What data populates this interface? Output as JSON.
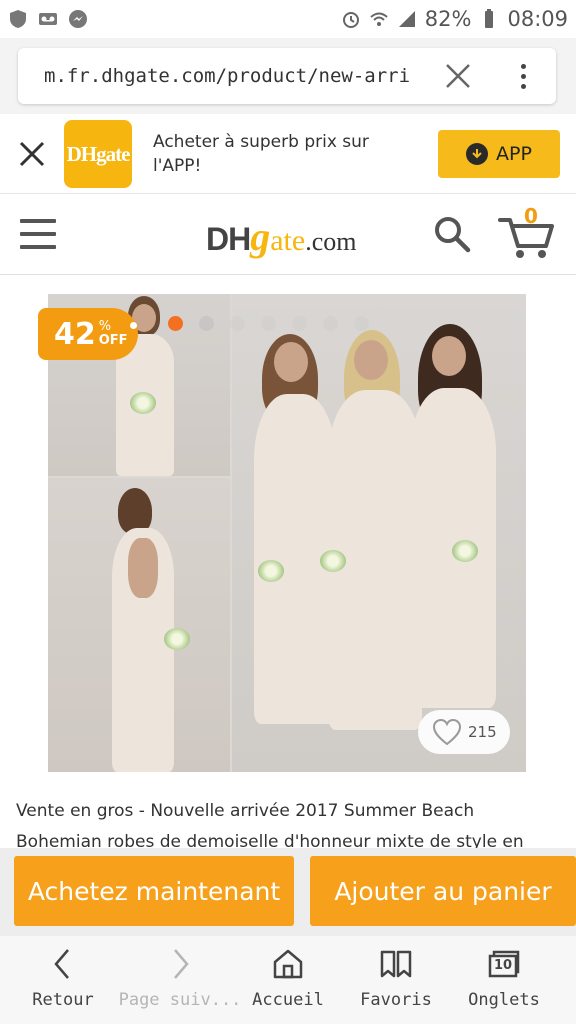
{
  "status_bar": {
    "battery": "82%",
    "time": "08:09"
  },
  "url_bar": {
    "url": "m.fr.dhgate.com/product/new-arri"
  },
  "app_banner": {
    "logo_text": "DHgate",
    "message": "Acheter à superb prix sur l'APP!",
    "button_label": "APP"
  },
  "header": {
    "logo": {
      "dh": "DH",
      "g": "g",
      "ate": "ate",
      "com": ".com"
    },
    "cart_count": "0"
  },
  "product": {
    "discount": {
      "number": "42",
      "percent": "%",
      "off": "OFF"
    },
    "likes": "215",
    "title": "Vente en gros - Nouvelle arrivée 2017 Summer Beach Bohemian robes de demoiselle d'honneur mixte de style en mousseline de"
  },
  "actions": {
    "buy_now": "Achetez maintenant",
    "add_to_cart": "Ajouter au panier"
  },
  "bottom_nav": {
    "back": "Retour",
    "forward": "Page suiv...",
    "home": "Accueil",
    "bookmarks": "Favoris",
    "tabs": "Onglets",
    "tabs_count": "10"
  },
  "colors": {
    "accent_orange": "#f7a01b",
    "brand_yellow": "#f6b60f",
    "carousel_active": "#f37021"
  }
}
